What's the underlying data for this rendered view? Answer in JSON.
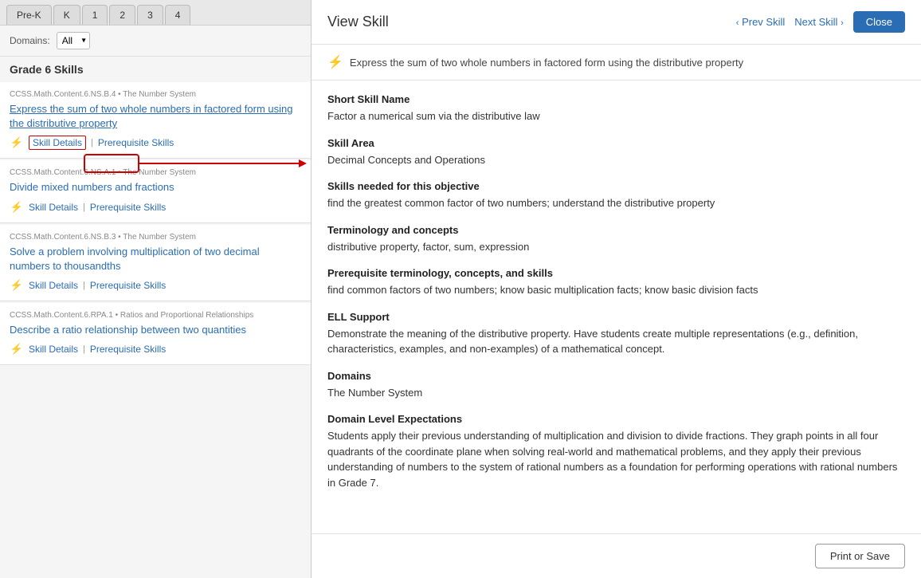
{
  "left": {
    "grade_tabs": [
      "Pre-K",
      "K",
      "1",
      "2",
      "3",
      "4"
    ],
    "domains_label": "Domains:",
    "domains_value": "All",
    "section_title": "Grade 6 Skills",
    "skills": [
      {
        "standard": "CCSS.Math.Content.6.NS.B.4 • The Number System",
        "title": "Express the sum of two whole numbers in factored form using the distributive property",
        "actions": [
          "Skill Details",
          "Prerequisite Skills"
        ],
        "highlighted": true
      },
      {
        "standard": "CCSS.Math.Content.6.NS.A.1 • The Number System",
        "title": "Divide mixed numbers and fractions",
        "actions": [
          "Skill Details",
          "Prerequisite Skills"
        ],
        "highlighted": false
      },
      {
        "standard": "CCSS.Math.Content.6.NS.B.3 • The Number System",
        "title": "Solve a problem involving multiplication of two decimal numbers to thousandths",
        "actions": [
          "Skill Details",
          "Prerequisite Skills"
        ],
        "highlighted": false
      },
      {
        "standard": "CCSS.Math.Content.6.RPA.1 • Ratios and Proportional Relationships",
        "title": "Describe a ratio relationship between two quantities",
        "actions": [
          "Skill Details",
          "Prerequisite Skills"
        ],
        "highlighted": false
      }
    ]
  },
  "modal": {
    "title": "View Skill",
    "prev_label": "Prev Skill",
    "next_label": "Next Skill",
    "close_label": "Close",
    "headline": "Express the sum of two whole numbers in factored form using the distributive property",
    "fields": [
      {
        "label": "Short Skill Name",
        "value": "Factor a numerical sum via the distributive law"
      },
      {
        "label": "Skill Area",
        "value": "Decimal Concepts and Operations"
      },
      {
        "label": "Skills needed for this objective",
        "value": "find the greatest common factor of two numbers; understand the distributive property"
      },
      {
        "label": "Terminology and concepts",
        "value": "distributive property, factor, sum, expression"
      },
      {
        "label": "Prerequisite terminology, concepts, and skills",
        "value": "find common factors of two numbers; know basic multiplication facts; know basic division facts"
      },
      {
        "label": "ELL Support",
        "value": "Demonstrate the meaning of the distributive property. Have students create multiple representations (e.g., definition, characteristics, examples, and non-examples) of a mathematical concept."
      },
      {
        "label": "Domains",
        "value": "The Number System"
      },
      {
        "label": "Domain Level Expectations",
        "value": "Students apply their previous understanding of multiplication and division to divide fractions. They graph points in all four quadrants of the coordinate plane when solving real-world and mathematical problems, and they apply their previous understanding of numbers to the system of rational numbers as a foundation for performing operations with rational numbers in Grade 7."
      }
    ],
    "footer": {
      "print_save_label": "Print or Save"
    }
  },
  "icons": {
    "lightning": "⚡",
    "chevron_left": "‹",
    "chevron_right": "›"
  }
}
